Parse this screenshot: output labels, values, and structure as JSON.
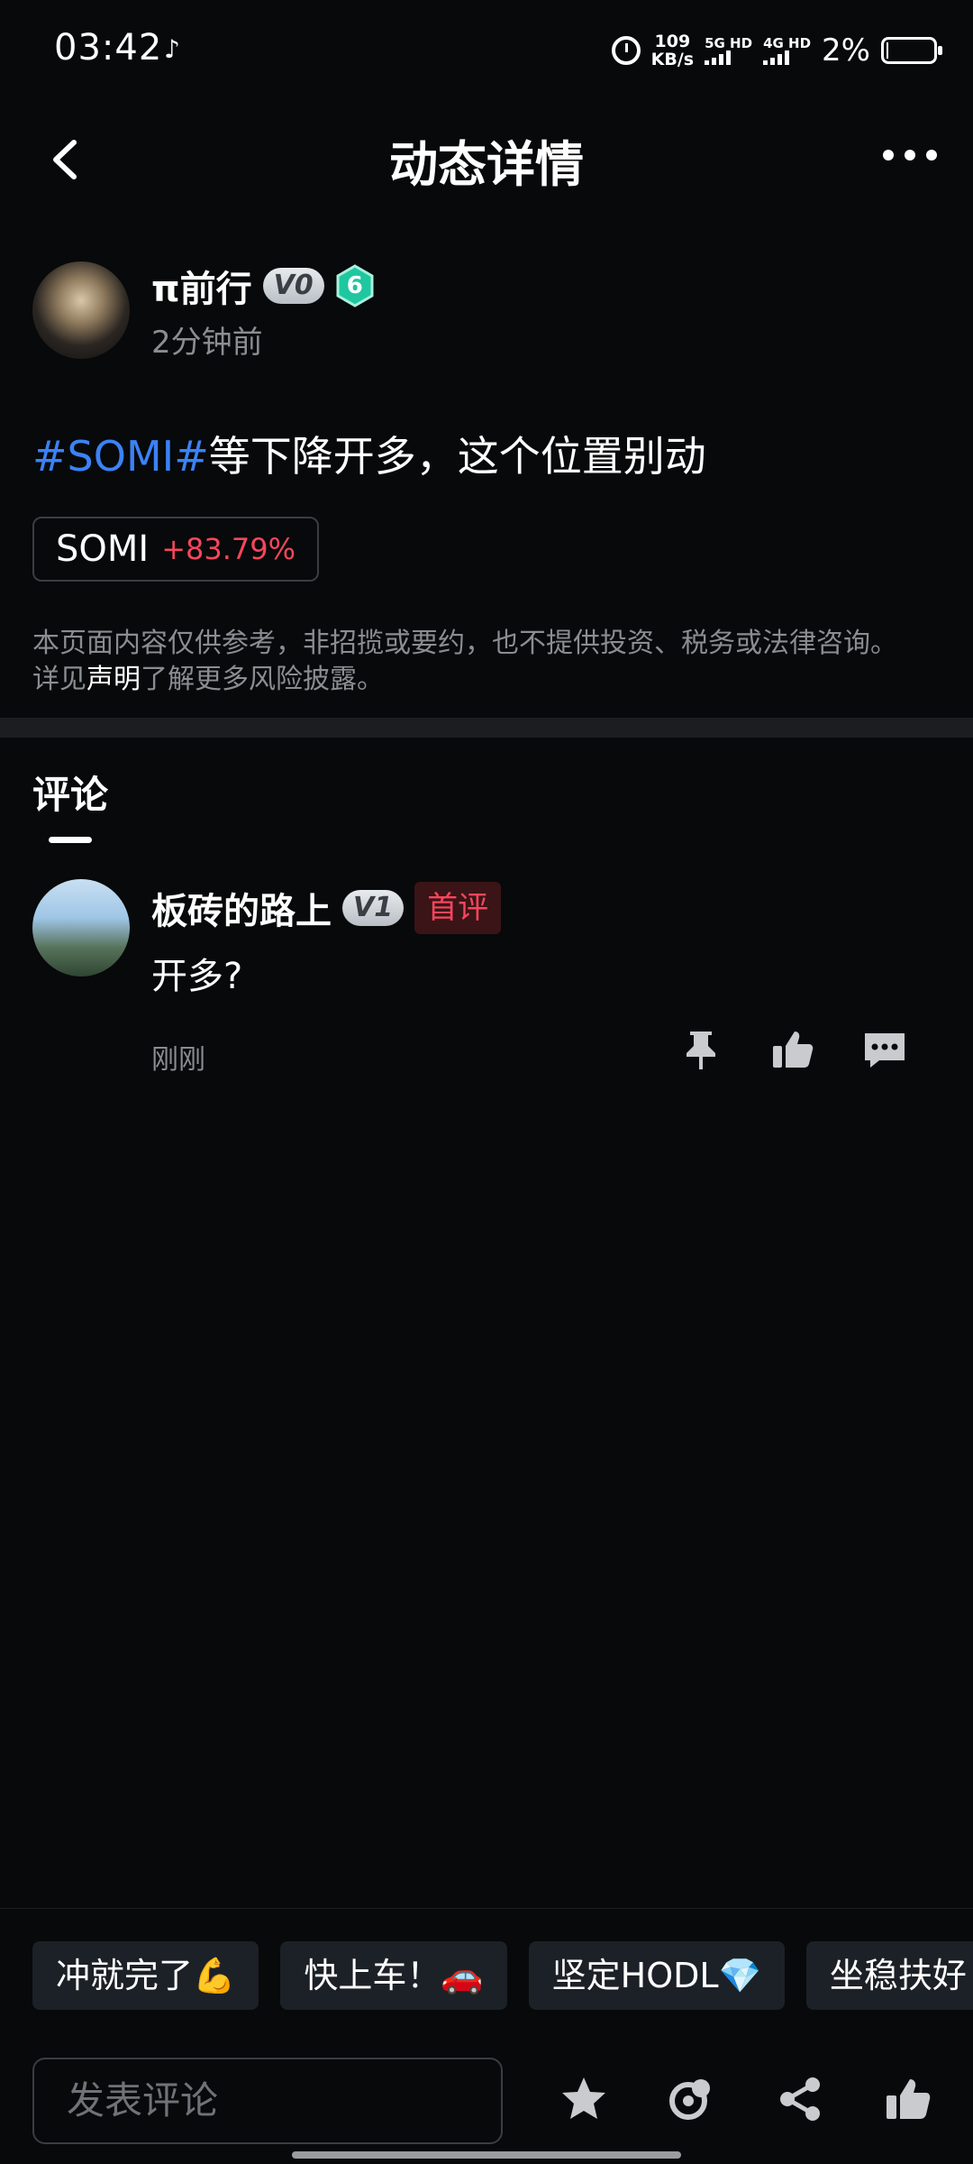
{
  "status_bar": {
    "time": "03:42",
    "speed_value": "109",
    "speed_unit": "KB/s",
    "net1": "5G HD",
    "net2": "4G HD",
    "battery": "2%"
  },
  "nav": {
    "title": "动态详情"
  },
  "author": {
    "name": "π前行",
    "vip_badge": "V0",
    "level": "6",
    "time": "2分钟前"
  },
  "post": {
    "hashtag": "#SOMI#",
    "text": "等下降开多，这个位置别动",
    "coin_symbol": "SOMI",
    "coin_change": "+83.79%",
    "disclaimer_line1": "本页面内容仅供参考，非招揽或要约，也不提供投资、税务或法律咨询。",
    "disclaimer_prefix": "详见",
    "disclaimer_link": "声明",
    "disclaimer_suffix": "了解更多风险披露。"
  },
  "comments": {
    "tab_label": "评论",
    "items": [
      {
        "name": "板砖的路上",
        "vip_badge": "V1",
        "tag": "首评",
        "text": "开多?",
        "time": "刚刚"
      }
    ]
  },
  "quick_replies": [
    "冲就完了💪",
    "快上车！🚗",
    "坚定HODL💎",
    "坐稳扶好"
  ],
  "input": {
    "placeholder": "发表评论"
  },
  "colors": {
    "background": "#07090a",
    "hashtag": "#3b82f6",
    "positive_change": "#f6465d",
    "muted_text": "#8a8d91",
    "level_badge": "#1fc7a0"
  },
  "icons": [
    "back-icon",
    "more-icon",
    "pin-icon",
    "like-icon",
    "reply-icon",
    "star-icon",
    "coin-icon",
    "share-icon",
    "thumbs-up-icon"
  ]
}
